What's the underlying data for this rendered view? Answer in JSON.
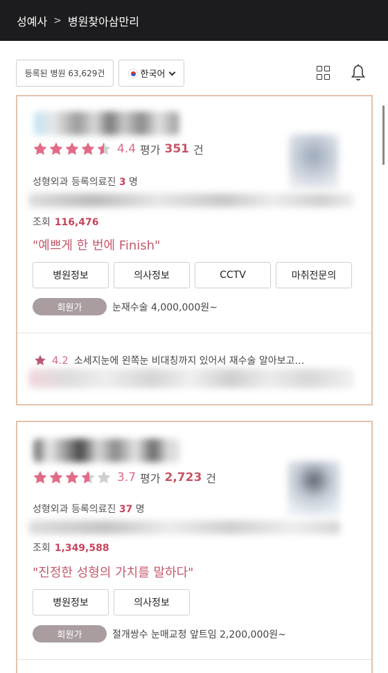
{
  "header": {
    "site": "성예사",
    "separator": ">",
    "section": "병원찾아삼만리"
  },
  "toolbar": {
    "registered_count": "등록된 병원 63,629건",
    "language": "한국어",
    "icons": {
      "grid": "grid-view-icon",
      "bell": "bell-icon",
      "flag": "korea-flag-icon",
      "chevron": "chevron-down-icon"
    }
  },
  "colors": {
    "header_bg": "#1c1b1d",
    "card_border": "#e2c2ad",
    "accent_pink": "#d96b84",
    "badge_gray": "#a99da0"
  },
  "cards": [
    {
      "rating": 4.4,
      "rating_text": "4.4",
      "rating_label": "평가",
      "review_count": "351",
      "count_unit": "건",
      "doctors_label": "성형외과 등록의료진",
      "doctors_count": "3",
      "doctors_unit": "명",
      "views_label": "조회",
      "views": "116,476",
      "slogan": "\"예쁘게 한 번에 Finish\"",
      "buttons": [
        "병원정보",
        "의사정보",
        "CCTV",
        "마취전문의"
      ],
      "member_badge": "회원가",
      "price": "눈재수술 4,000,000원~",
      "review": {
        "rating": "4.2",
        "text": "소세지눈에 왼쪽눈 비대칭까지 있어서 재수술 알아보고…"
      }
    },
    {
      "rating": 3.7,
      "rating_text": "3.7",
      "rating_label": "평가",
      "review_count": "2,723",
      "count_unit": "건",
      "doctors_label": "성형외과 등록의료진",
      "doctors_count": "37",
      "doctors_unit": "명",
      "views_label": "조회",
      "views": "1,349,588",
      "slogan": "\"진정한 성형의 가치를 말하다\"",
      "buttons": [
        "병원정보",
        "의사정보"
      ],
      "member_badge": "회원가",
      "price": "절개쌍수 눈매교정 앞트임 2,200,000원~"
    }
  ]
}
